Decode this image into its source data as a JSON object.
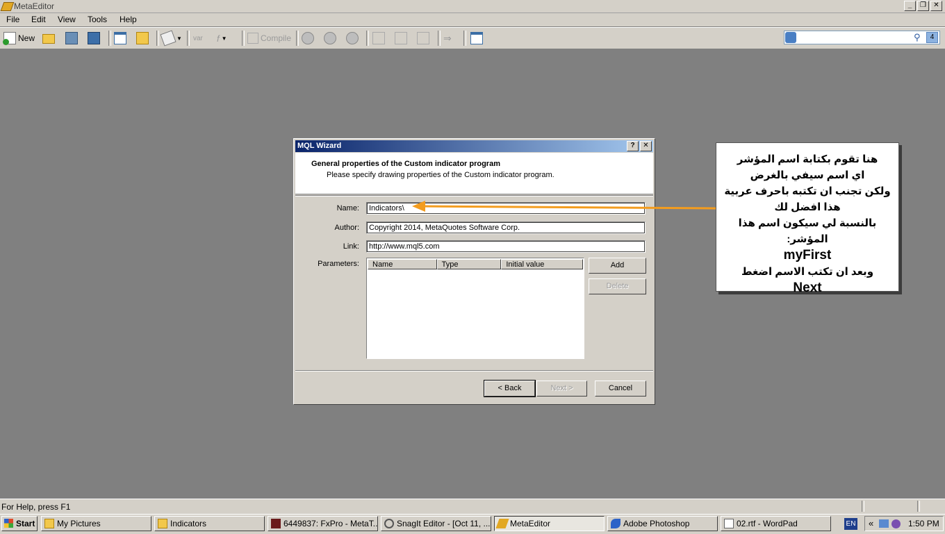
{
  "window": {
    "title": "MetaEditor"
  },
  "menu": [
    "File",
    "Edit",
    "View",
    "Tools",
    "Help"
  ],
  "toolbar": {
    "new_label": "New",
    "compile_label": "Compile",
    "badge": "4"
  },
  "status": {
    "help_text": "For Help, press F1"
  },
  "dialog": {
    "title": "MQL Wizard",
    "heading": "General properties of the Custom indicator program",
    "subheading": "Please specify drawing properties of the Custom indicator program.",
    "name_label": "Name:",
    "name_value": "Indicators\\",
    "author_label": "Author:",
    "author_value": "Copyright 2014, MetaQuotes Software Corp.",
    "link_label": "Link:",
    "link_value": "http://www.mql5.com",
    "parameters_label": "Parameters:",
    "columns": [
      "Name",
      "Type",
      "Initial value"
    ],
    "add_label": "Add",
    "delete_label": "Delete",
    "back_label": "< Back",
    "next_label": "Next >",
    "cancel_label": "Cancel"
  },
  "callout": {
    "lines": [
      "هنا تقوم بكتابة اسم المؤشر",
      "اي اسم سيفي بالغرض",
      "ولكن تجنب ان تكتبه باحرف عربية",
      "هذا افضل لك",
      "بالنسبة لي سيكون اسم هذا المؤشر:",
      "myFirst",
      "وبعد ان تكتب الاسم اضغط",
      "Next"
    ],
    "arrow_color": "#f39c1e"
  },
  "taskbar": {
    "start_label": "Start",
    "tasks": [
      "My Pictures",
      "Indicators",
      "6449837: FxPro - MetaT...",
      "SnagIt Editor - [Oct 11, ...",
      "MetaEditor",
      "Adobe Photoshop",
      "02.rtf - WordPad"
    ],
    "lang": "EN",
    "time": "1:50 PM"
  }
}
